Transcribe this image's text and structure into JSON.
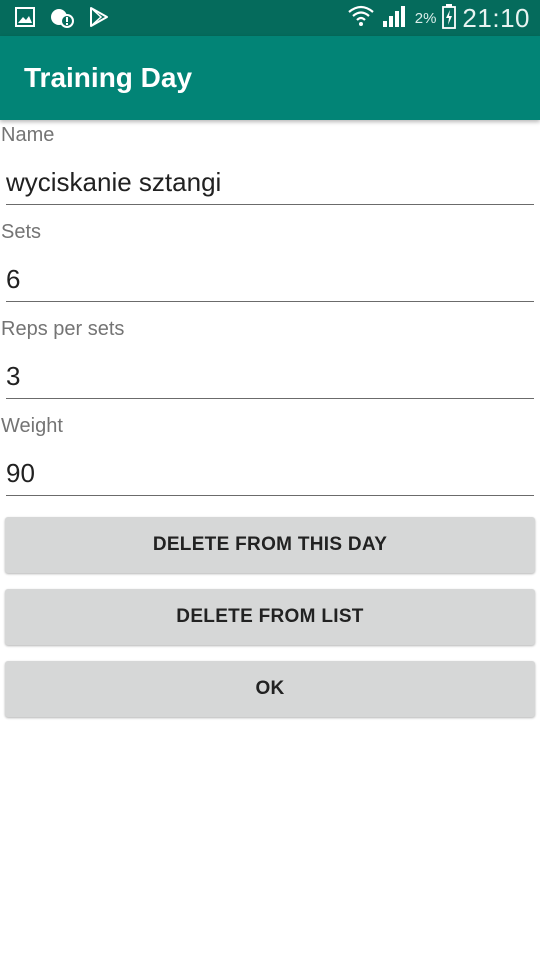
{
  "status_bar": {
    "icons": [
      "gallery-icon",
      "notification-icon",
      "play-store-icon",
      "wifi-icon",
      "signal-icon",
      "battery-icon"
    ],
    "battery_percent": "2%",
    "time": "21:10"
  },
  "app_bar": {
    "title": "Training Day",
    "color": "#028476"
  },
  "form": {
    "name": {
      "label": "Name",
      "value": "wyciskanie sztangi"
    },
    "sets": {
      "label": "Sets",
      "value": "6"
    },
    "reps": {
      "label": "Reps per sets",
      "value": "3"
    },
    "weight": {
      "label": "Weight",
      "value": "90"
    }
  },
  "buttons": {
    "delete_day": "DELETE FROM THIS DAY",
    "delete_list": "DELETE FROM LIST",
    "ok": "OK"
  }
}
